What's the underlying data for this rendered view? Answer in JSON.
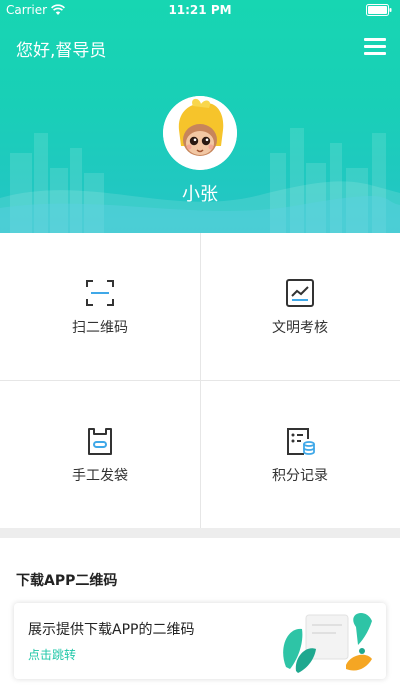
{
  "status_bar": {
    "carrier": "Carrier",
    "time": "11:21 PM"
  },
  "header": {
    "greeting": "您好,督导员",
    "user_name": "小张"
  },
  "grid": {
    "items": [
      {
        "label": "扫二维码",
        "icon": "scan-icon"
      },
      {
        "label": "文明考核",
        "icon": "assessment-icon"
      },
      {
        "label": "手工发袋",
        "icon": "bag-icon"
      },
      {
        "label": "积分记录",
        "icon": "points-record-icon"
      }
    ]
  },
  "download_section": {
    "title": "下载APP二维码",
    "card_title": "展示提供下载APP的二维码",
    "card_link": "点击跳转"
  },
  "colors": {
    "accent": "#19cfb7",
    "link": "#1fc7a8",
    "icon_blue": "#3fa8e8"
  }
}
